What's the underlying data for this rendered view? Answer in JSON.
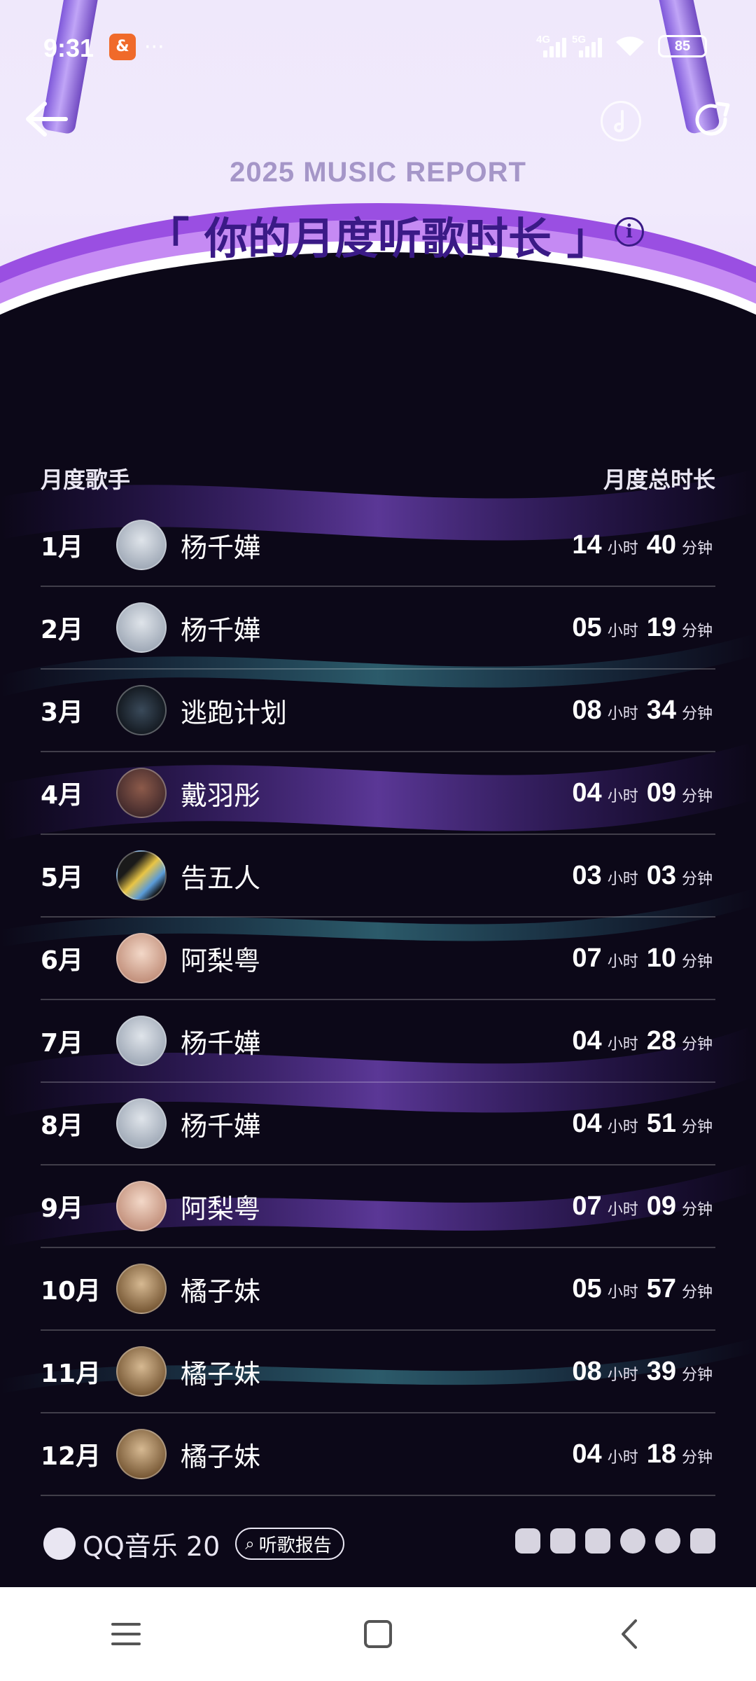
{
  "status_bar": {
    "time": "9:31",
    "app_icon_text": "&",
    "more": "···",
    "net1": "4G",
    "net2": "5G",
    "battery": "85"
  },
  "header": {
    "report_title": "2025 MUSIC REPORT",
    "main_title": "「 你的月度听歌时长 」",
    "info_symbol": "i"
  },
  "table": {
    "col_artist": "月度歌手",
    "col_duration": "月度总时长",
    "hour_unit": "小时",
    "minute_unit": "分钟",
    "rows": [
      {
        "month": "1月",
        "artist": "杨千嬅",
        "hours": "14",
        "minutes": "40"
      },
      {
        "month": "2月",
        "artist": "杨千嬅",
        "hours": "05",
        "minutes": "19"
      },
      {
        "month": "3月",
        "artist": "逃跑计划",
        "hours": "08",
        "minutes": "34"
      },
      {
        "month": "4月",
        "artist": "戴羽彤",
        "hours": "04",
        "minutes": "09"
      },
      {
        "month": "5月",
        "artist": "告五人",
        "hours": "03",
        "minutes": "03"
      },
      {
        "month": "6月",
        "artist": "阿梨粤",
        "hours": "07",
        "minutes": "10"
      },
      {
        "month": "7月",
        "artist": "杨千嬅",
        "hours": "04",
        "minutes": "28"
      },
      {
        "month": "8月",
        "artist": "杨千嬅",
        "hours": "04",
        "minutes": "51"
      },
      {
        "month": "9月",
        "artist": "阿梨粤",
        "hours": "07",
        "minutes": "09"
      },
      {
        "month": "10月",
        "artist": "橘子妹",
        "hours": "05",
        "minutes": "57"
      },
      {
        "month": "11月",
        "artist": "橘子妹",
        "hours": "08",
        "minutes": "39"
      },
      {
        "month": "12月",
        "artist": "橘子妹",
        "hours": "04",
        "minutes": "18"
      }
    ]
  },
  "footer": {
    "brand": "QQ音乐 20",
    "report_pill": "听歌报告"
  },
  "colors": {
    "title_purple": "#3a1a86",
    "subtitle_grey_purple": "#a596c8",
    "dark_bg": "#0c0818"
  }
}
